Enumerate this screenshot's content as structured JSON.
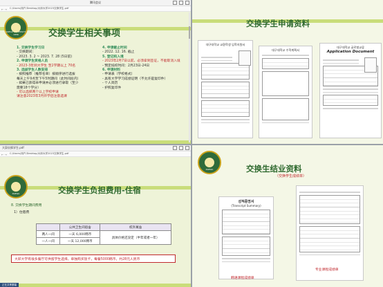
{
  "q1": {
    "window_title": "腾讯会议",
    "address": "C:/Users/用户/Desktop/大邱大学2023交换学生.pdf",
    "title": "交换学生相关事项",
    "seal_text": "DAEGU UNIVERSITY 1956",
    "left_items": [
      "1. 交换学生学习日",
      "- 交换期间：",
      "- 2023. 3. 2 ~ 2023. 7. 28 (5日前)",
      "2. 申请学生资格人员",
      "- 2023-3年到大学生 至2学期以上 70名",
      "",
      "3. 选拔学生人数安排",
      "- 按照推荐（推荐名单）按顺序进行选拔",
      "  每天上午9点至下午5时期间（此时间段内）",
      "- 如果已获得本申请并必须进行录取（至少",
      "  需要18个学分）",
      "- 可以选择两个以上学校申请",
      "  请注意2023年3月开学后注意选课"
    ],
    "right_items": [
      "4. 申请截止时间",
      "- 2022. 12. 16. 截止",
      "5. 登记和入境",
      "- 2023年2月7日以前，必须拿到签证，不能取消入境",
      "- 预定抵校时间：2月23日-24日",
      "6. 申请材料",
      "- 申请表（学校格式）",
      "- 具有大学学习成绩证明（不允许是复印件）",
      "- 个人简历",
      "- 护照复印件"
    ]
  },
  "q2": {
    "title": "交换学生申请资料",
    "docs": [
      {
        "heading": "대구대학교 교환학생 입학지원서"
      },
      {
        "heading": "대구대학교 수학계획서"
      },
      {
        "heading": "대구대학교 글로벌교류",
        "subheading": "Application Document"
      }
    ]
  },
  "q3": {
    "window_title": "大邱交换学生.pdf",
    "address": "C:/Users/用户/Desktop/大邱大学2023交换学生.pdf",
    "title": "交换学生负担费用-住宿",
    "section": "8. 交换学生期间费用",
    "subsection": "1）住宿费",
    "table_headers": [
      "",
      "公共卫生间宿舍",
      "校外寓舍"
    ],
    "table_rows": [
      [
        "两人一间",
        "一天 6,000韩币",
        "具体价格还没定（半年或者一年）"
      ],
      [
        "一人一间",
        "一天 12,000韩币",
        ""
      ]
    ],
    "note": "大邱大学有很多餐厅可供留学生选择，单独购买饭卡，每餐5000韩币，约28元人民币",
    "status": "正在共享屏幕"
  },
  "q4": {
    "title": "交换生结业资料",
    "subtitle": "（交换学生成绩单）",
    "left_doc_korean": "성적증명서",
    "left_doc_english": "(Transcript Summary)",
    "left_caption": "韩语课程成绩单",
    "right_caption": "专业课程成绩单"
  },
  "colors": {
    "accent_green": "#2f6a2f",
    "accent_red": "#c0282d"
  }
}
